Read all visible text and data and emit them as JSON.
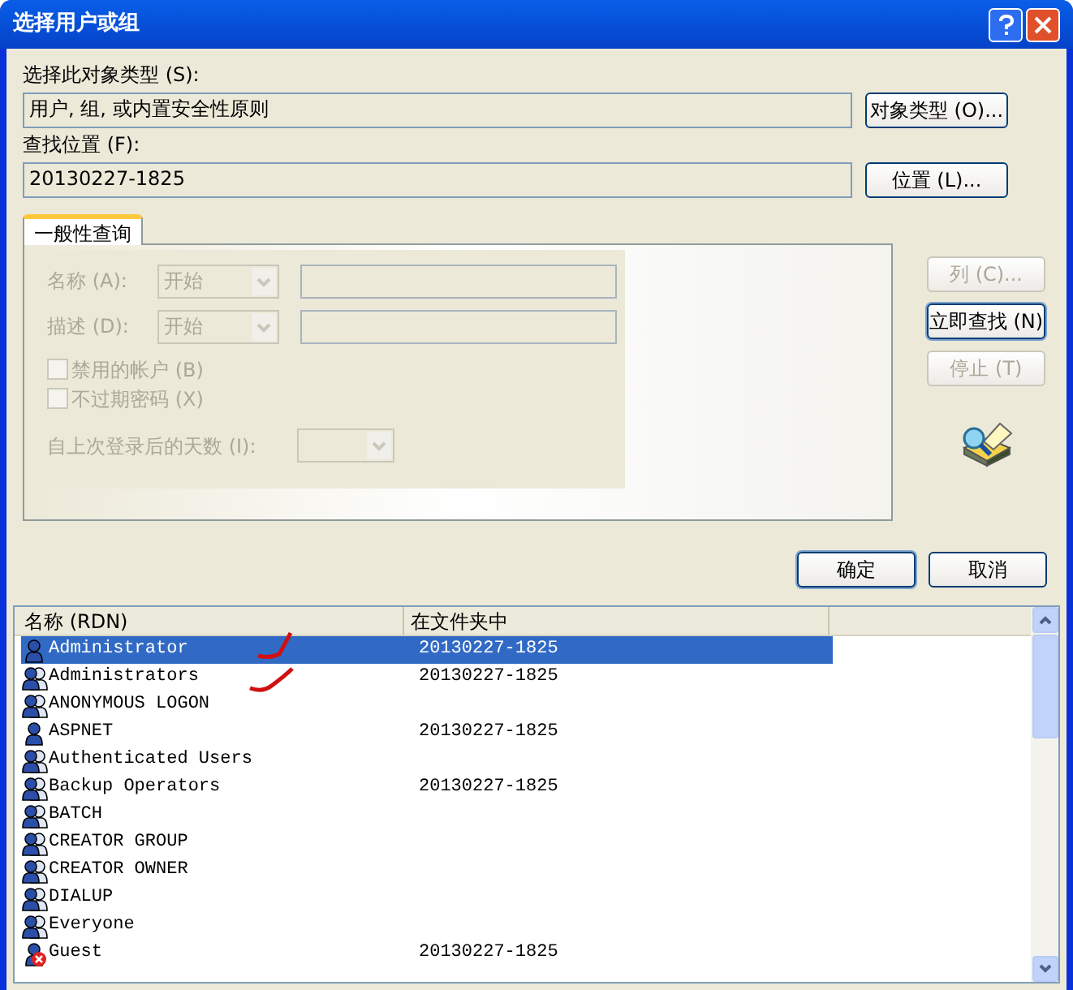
{
  "window": {
    "title": "选择用户或组"
  },
  "object_type": {
    "label": "选择此对象类型 (S):",
    "value": "用户, 组, 或内置安全性原则",
    "button": "对象类型 (O)..."
  },
  "location": {
    "label": "查找位置 (F):",
    "value": "20130227-1825",
    "button": "位置 (L)..."
  },
  "tabs": [
    {
      "label": "一般性查询",
      "selected": true
    }
  ],
  "query": {
    "fields": [
      {
        "label": "名称 (A):",
        "mode": "开始",
        "disabled": true
      },
      {
        "label": "描述 (D):",
        "mode": "开始",
        "disabled": true
      }
    ],
    "checkboxes": [
      {
        "label": "禁用的帐户 (B)",
        "checked": false,
        "disabled": true
      },
      {
        "label": "不过期密码 (X)",
        "checked": false,
        "disabled": true
      }
    ],
    "days": {
      "label": "自上次登录后的天数 (I):",
      "disabled": true
    }
  },
  "side_buttons": [
    {
      "label": "列 (C)...",
      "disabled": true
    },
    {
      "label": "立即查找 (N)",
      "disabled": false
    },
    {
      "label": "停止 (T)",
      "disabled": true
    }
  ],
  "dialog_buttons": [
    "确定",
    "取消"
  ],
  "table": {
    "columns": [
      "名称 (RDN)",
      "在文件夹中"
    ],
    "rows": [
      {
        "name": "Administrator",
        "folder": "20130227-1825",
        "kind": "user",
        "selected": true
      },
      {
        "name": "Administrators",
        "folder": "20130227-1825",
        "kind": "group",
        "selected": false
      },
      {
        "name": "ANONYMOUS LOGON",
        "kind": "group",
        "selected": false
      },
      {
        "name": "ASPNET",
        "folder": "20130227-1825",
        "kind": "user",
        "selected": false
      },
      {
        "name": "Authenticated Users",
        "kind": "group",
        "selected": false
      },
      {
        "name": "Backup Operators",
        "folder": "20130227-1825",
        "kind": "group",
        "selected": false
      },
      {
        "name": "BATCH",
        "kind": "group",
        "selected": false
      },
      {
        "name": "CREATOR GROUP",
        "kind": "group",
        "selected": false
      },
      {
        "name": "CREATOR OWNER",
        "kind": "group",
        "selected": false
      },
      {
        "name": "DIALUP",
        "kind": "group",
        "selected": false
      },
      {
        "name": "Everyone",
        "kind": "group",
        "selected": false
      },
      {
        "name": "Guest",
        "folder": "20130227-1825",
        "kind": "disabled_user",
        "selected": false
      }
    ]
  }
}
